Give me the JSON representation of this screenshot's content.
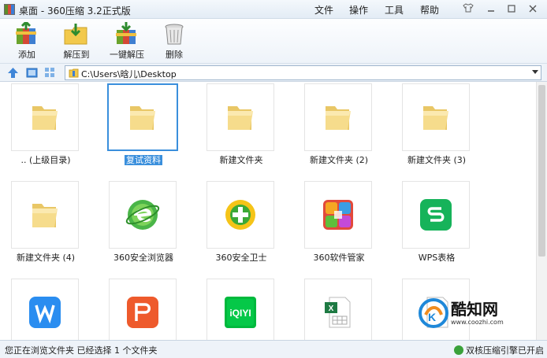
{
  "window": {
    "title": "桌面 - 360压缩 3.2正式版"
  },
  "menu": {
    "file": "文件",
    "operate": "操作",
    "tools": "工具",
    "help": "帮助"
  },
  "toolbar": {
    "add": "添加",
    "extract_to": "解压到",
    "one_click_extract": "一键解压",
    "delete": "删除"
  },
  "address": {
    "path": "C:\\Users\\晗儿\\Desktop"
  },
  "items": [
    {
      "label": ".. (上级目录)",
      "icon": "folder-icon"
    },
    {
      "label": "复试资料",
      "icon": "folder-icon",
      "selected": true
    },
    {
      "label": "新建文件夹",
      "icon": "folder-icon"
    },
    {
      "label": "新建文件夹 (2)",
      "icon": "folder-icon"
    },
    {
      "label": "新建文件夹 (3)",
      "icon": "folder-icon"
    },
    {
      "label": "新建文件夹 (4)",
      "icon": "folder-icon"
    },
    {
      "label": "360安全浏览器",
      "icon": "360-browser-icon"
    },
    {
      "label": "360安全卫士",
      "icon": "360-safeguard-icon"
    },
    {
      "label": "360软件管家",
      "icon": "360-software-manager-icon"
    },
    {
      "label": "WPS表格",
      "icon": "wps-spreadsheet-icon"
    },
    {
      "label": "",
      "icon": "wps-writer-icon"
    },
    {
      "label": "",
      "icon": "wps-presentation-icon"
    },
    {
      "label": "",
      "icon": "iqiyi-icon"
    },
    {
      "label": "",
      "icon": "excel-file-icon"
    },
    {
      "label": "",
      "icon": "generic-file-icon"
    }
  ],
  "status": {
    "left": "您正在浏览文件夹 已经选择 1 个文件夹",
    "right": "双核压缩引擎已开启"
  },
  "watermark": {
    "brand": "酷知网",
    "url": "www.coozhi.com"
  },
  "colors": {
    "selection": "#3a8fdc",
    "folder": "#f2d77e"
  }
}
